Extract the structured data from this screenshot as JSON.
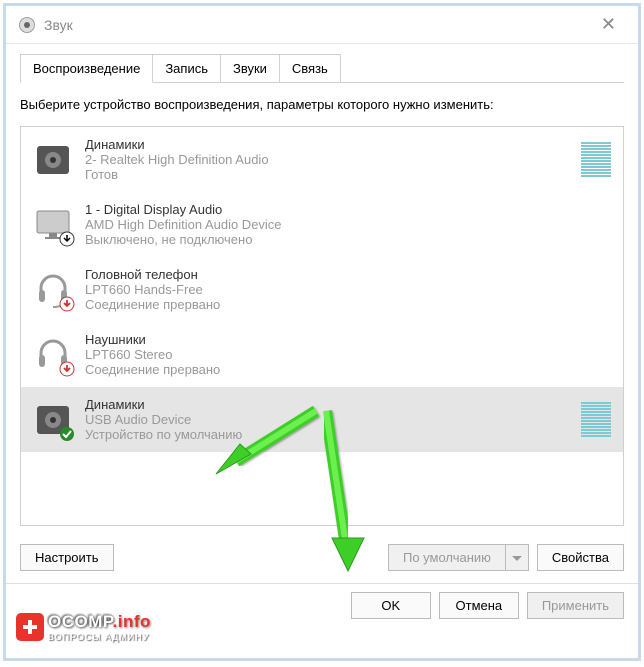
{
  "window": {
    "title": "Звук"
  },
  "tabs": [
    {
      "label": "Воспроизведение",
      "active": true
    },
    {
      "label": "Запись"
    },
    {
      "label": "Звуки"
    },
    {
      "label": "Связь"
    }
  ],
  "instruction": "Выберите устройство воспроизведения, параметры которого нужно изменить:",
  "devices": [
    {
      "icon": "speaker",
      "name": "Динамики",
      "desc": "2- Realtek High Definition Audio",
      "status": "Готов",
      "level_active": true,
      "selected": false
    },
    {
      "icon": "monitor",
      "badge": "down",
      "name": "1 - Digital Display Audio",
      "desc": "AMD High Definition Audio Device",
      "status": "Выключено, не подключено",
      "selected": false
    },
    {
      "icon": "headset",
      "badge": "down-red",
      "name": "Головной телефон",
      "desc": "LPT660 Hands-Free",
      "status": "Соединение прервано",
      "selected": false
    },
    {
      "icon": "headphones",
      "badge": "down-red",
      "name": "Наушники",
      "desc": "LPT660 Stereo",
      "status": "Соединение прервано",
      "selected": false
    },
    {
      "icon": "speaker",
      "badge": "check",
      "name": "Динамики",
      "desc": "USB Audio Device",
      "status": "Устройство по умолчанию",
      "level_active": true,
      "selected": true
    }
  ],
  "buttons": {
    "configure": "Настроить",
    "default": "По умолчанию",
    "properties": "Свойства",
    "ok": "OK",
    "cancel": "Отмена",
    "apply": "Применить"
  },
  "watermark": {
    "brand1": "OCOMP",
    "brand2": ".info",
    "sub": "ВОПРОСЫ АДМИНУ"
  }
}
